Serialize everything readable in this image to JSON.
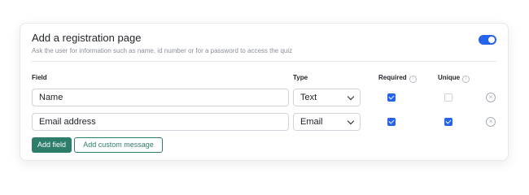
{
  "section": {
    "title": "Add a registration page",
    "subtitle": "Ask the user for information such as name, id number or for a password to access the quiz",
    "enabled": true
  },
  "columns": {
    "field": "Field",
    "type": "Type",
    "required": "Required",
    "unique": "Unique"
  },
  "rows": [
    {
      "field": "Name",
      "type": "Text",
      "required": true,
      "unique": false
    },
    {
      "field": "Email address",
      "type": "Email",
      "required": true,
      "unique": true
    }
  ],
  "buttons": {
    "add_field": "Add field",
    "add_custom_message": "Add custom message"
  },
  "colors": {
    "accent": "#2563eb",
    "primary_button": "#2e7d6b"
  }
}
